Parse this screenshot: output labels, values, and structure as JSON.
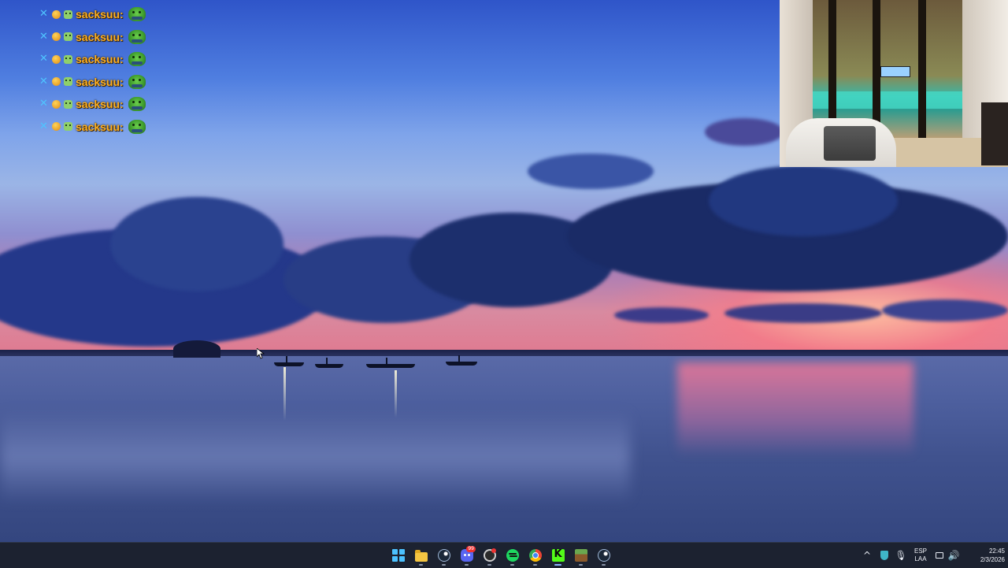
{
  "chat": {
    "messages": [
      {
        "username": "sacksuu:"
      },
      {
        "username": "sacksuu:"
      },
      {
        "username": "sacksuu:"
      },
      {
        "username": "sacksuu:"
      },
      {
        "username": "sacksuu:"
      },
      {
        "username": "sacksuu:"
      }
    ],
    "username_color": "#ffb020",
    "badges": [
      "sword-badge-icon",
      "coin-badge-icon",
      "bot-badge-icon"
    ],
    "emote": "frog-emote-icon"
  },
  "taskbar": {
    "apps": [
      {
        "name": "start",
        "icon": "windows-start-icon"
      },
      {
        "name": "file-explorer",
        "icon": "folder-icon"
      },
      {
        "name": "steam",
        "icon": "steam-icon"
      },
      {
        "name": "discord",
        "icon": "discord-icon",
        "badge": "99"
      },
      {
        "name": "obs",
        "icon": "obs-icon"
      },
      {
        "name": "spotify",
        "icon": "spotify-icon"
      },
      {
        "name": "chrome",
        "icon": "chrome-icon"
      },
      {
        "name": "kick",
        "icon": "kick-icon"
      },
      {
        "name": "minecraft",
        "icon": "minecraft-icon"
      },
      {
        "name": "steam-2",
        "icon": "steam-icon"
      }
    ],
    "tray": {
      "chevron": "^",
      "language_line1": "ESP",
      "language_line2": "LAA",
      "time": "22:45",
      "date": "2/3/2026"
    },
    "accent": "#1c2230"
  },
  "colors": {
    "sky_top": "#2f55c9",
    "sunset_pink": "#e07a90",
    "sea": "#40528e"
  }
}
